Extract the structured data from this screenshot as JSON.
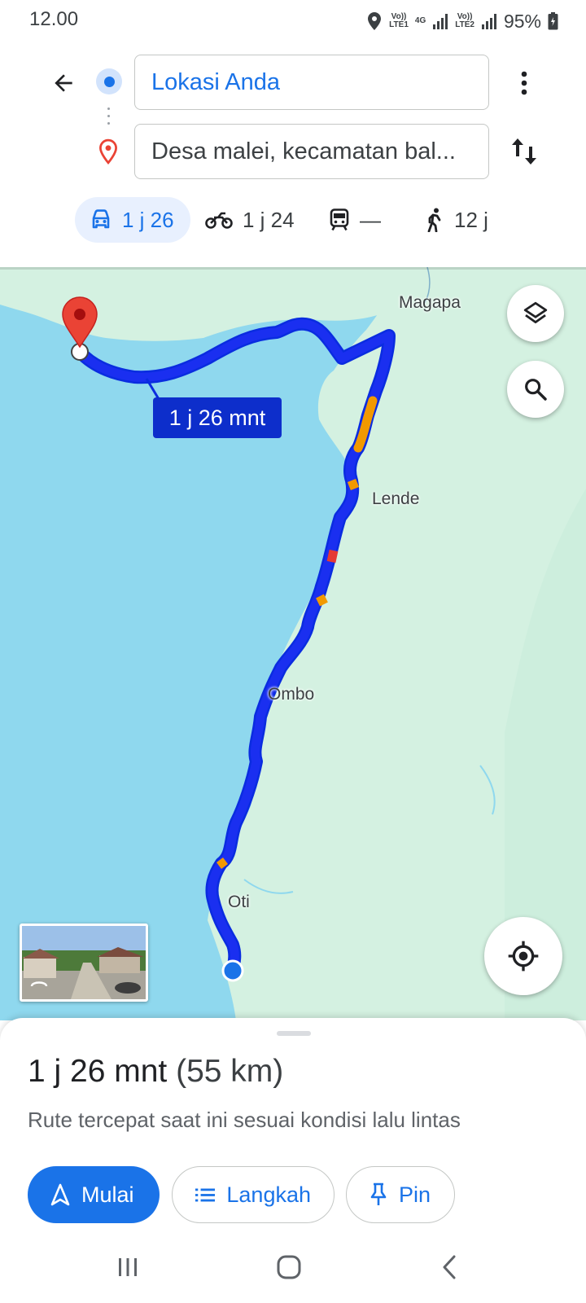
{
  "status_bar": {
    "time": "12.00",
    "sim1_top": "Vo))",
    "sim1_bottom": "LTE1",
    "network": "4G",
    "sim2_top": "Vo))",
    "sim2_bottom": "LTE2",
    "battery": "95%",
    "icons": [
      "location-icon",
      "signal-icon",
      "battery-icon"
    ]
  },
  "header": {
    "origin": "Lokasi Anda",
    "destination": "Desa malei, kecamatan bal...",
    "icons": [
      "back-arrow-icon",
      "more-vert-icon",
      "swap-icon",
      "destination-pin-icon"
    ]
  },
  "travel_modes": [
    {
      "mode": "car",
      "label": "1 j 26",
      "active": true
    },
    {
      "mode": "motorcycle",
      "label": "1 j 24",
      "active": false
    },
    {
      "mode": "transit",
      "label": "—",
      "active": false
    },
    {
      "mode": "walk",
      "label": "12 j",
      "active": false
    }
  ],
  "map": {
    "route_time_label": "1 j 26 mnt",
    "places": [
      "Magapa",
      "Lende",
      "Ombo",
      "Oti"
    ],
    "colors": {
      "water": "#8fd8ee",
      "land": "#d4f1e1",
      "route": "#1a2ff0",
      "traffic_slow": "#f29900",
      "traffic_jam": "#e53935",
      "pin": "#ea4335"
    }
  },
  "sheet": {
    "duration": "1 j 26 mnt",
    "distance": "(55 km)",
    "subtitle": "Rute tercepat saat ini sesuai kondisi lalu lintas",
    "start_label": "Mulai",
    "steps_label": "Langkah",
    "pin_label": "Pin"
  }
}
